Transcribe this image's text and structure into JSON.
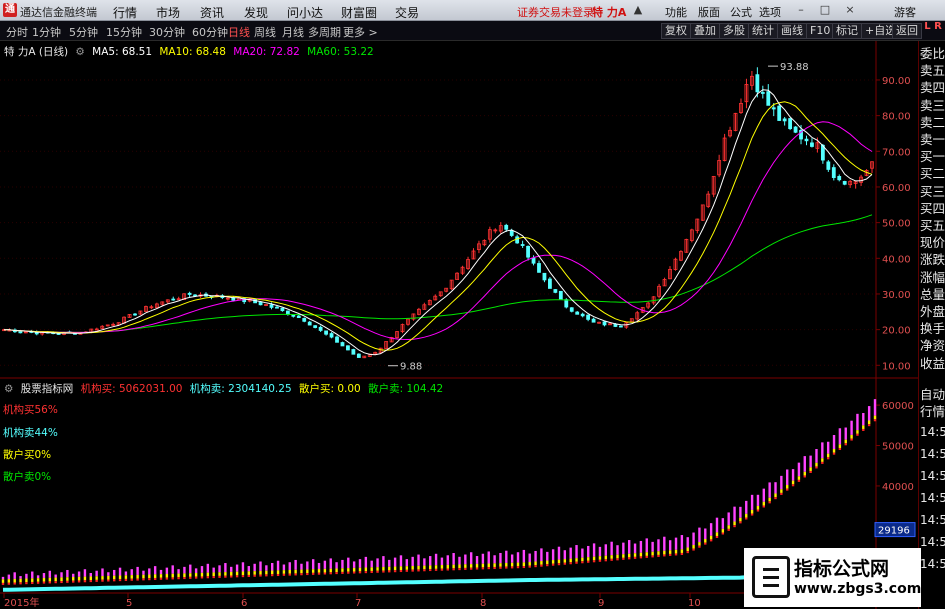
{
  "app": {
    "title": "通达信金融终端",
    "logo_char": "通",
    "menus": [
      "行情",
      "市场",
      "资讯",
      "发现",
      "问小达",
      "财富圈",
      "交易"
    ],
    "warning": "证券交易未登录",
    "stock_title": "特 力A",
    "right_menus": [
      "功能",
      "版面",
      "公式",
      "选项"
    ],
    "guest": "游客"
  },
  "toolbar": {
    "periods": [
      "分时",
      "1分钟",
      "5分钟",
      "15分钟",
      "30分钟",
      "60分钟",
      "日线",
      "周线",
      "月线",
      "多周期",
      "更多 >"
    ],
    "active_period": "日线",
    "right_buttons": [
      "复权",
      "叠加",
      "多股",
      "统计",
      "画线",
      "F10",
      "标记",
      "+自选",
      "返回"
    ],
    "lr_label": "L R"
  },
  "main_legend": {
    "name": "特 力A (日线)",
    "ma5": "MA5: 68.51",
    "ma10": "MA10: 68.48",
    "ma20": "MA20: 72.82",
    "ma60": "MA60: 53.22"
  },
  "sub_legend": {
    "name": "股票指标网",
    "b1": "机构买: 5062031.00",
    "b2": "机构卖: 2304140.25",
    "b3": "散户买: 0.00",
    "b4": "散户卖: 104.42",
    "p1": "机构买56%",
    "p2": "机构卖44%",
    "p3": "散户买0%",
    "p4": "散户卖0%"
  },
  "annotations": {
    "high": "93.88",
    "low": "9.88",
    "sub_marker": "29196"
  },
  "axes": {
    "price_ticks": [
      "90.00",
      "80.00",
      "70.00",
      "60.00",
      "50.00",
      "40.00",
      "30.00",
      "20.00",
      "10.00"
    ],
    "vol_ticks": [
      "60000",
      "50000",
      "40000",
      "30000",
      "20000"
    ],
    "months": [
      "2015年",
      "5",
      "6",
      "7",
      "8",
      "9",
      "10"
    ]
  },
  "right_panel": {
    "items": [
      "委比",
      "卖五",
      "卖四",
      "卖三",
      "卖二",
      "卖一",
      "买一",
      "买二",
      "买三",
      "买四",
      "买五",
      "现价",
      "涨跌",
      "涨幅",
      "总量",
      "外盘",
      "换手",
      "净资",
      "收益"
    ],
    "lower": [
      "自动",
      "行情"
    ],
    "times": [
      "14:50",
      "14:50",
      "14:50",
      "14:50",
      "14:50",
      "14:50",
      "14:50"
    ]
  },
  "watermark": {
    "line1": "指标公式网",
    "line2": "www.zbgs3.com"
  },
  "colors": {
    "up": "#ff3232",
    "down": "#54ffff",
    "ma5": "#ffffff",
    "ma10": "#ffff00",
    "ma20": "#ff00ff",
    "ma60": "#00e600",
    "grid": "#7a0000"
  },
  "chart_data": {
    "type": "line",
    "title": "特 力A (日线)",
    "x": [
      "2015-04",
      "2015-05",
      "2015-06",
      "2015-07",
      "2015-08",
      "2015-09",
      "2015-10"
    ],
    "close_path": [
      [
        0,
        20
      ],
      [
        20,
        19
      ],
      [
        40,
        19
      ],
      [
        60,
        22
      ],
      [
        80,
        27
      ],
      [
        100,
        30
      ],
      [
        120,
        29
      ],
      [
        140,
        27
      ],
      [
        160,
        23
      ],
      [
        180,
        16
      ],
      [
        190,
        12
      ],
      [
        200,
        14
      ],
      [
        215,
        22
      ],
      [
        235,
        31
      ],
      [
        255,
        44
      ],
      [
        265,
        50
      ],
      [
        275,
        45
      ],
      [
        285,
        37
      ],
      [
        300,
        27
      ],
      [
        315,
        22
      ],
      [
        330,
        21
      ],
      [
        345,
        27
      ],
      [
        360,
        40
      ],
      [
        375,
        55
      ],
      [
        385,
        72
      ],
      [
        395,
        85
      ],
      [
        400,
        92
      ],
      [
        408,
        84
      ],
      [
        420,
        76
      ],
      [
        435,
        72
      ],
      [
        445,
        63
      ],
      [
        455,
        61
      ],
      [
        465,
        66
      ]
    ],
    "ylim": [
      10,
      95
    ],
    "high": 93.88,
    "low": 9.88
  }
}
